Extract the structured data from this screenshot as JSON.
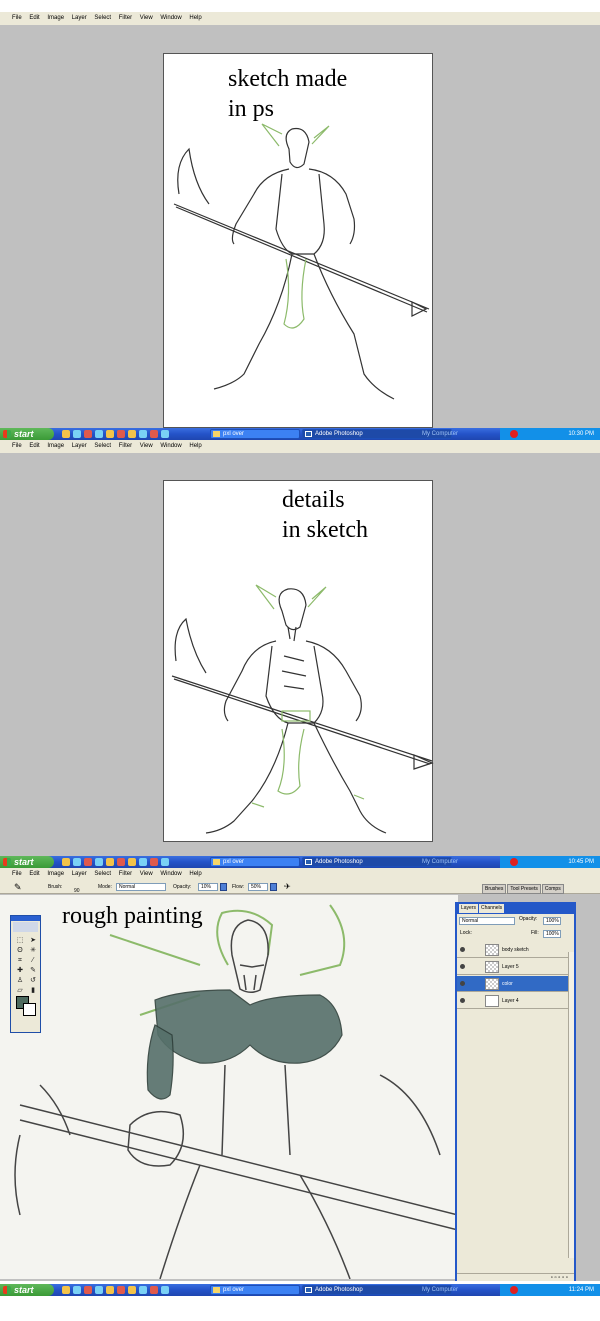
{
  "menu": [
    "File",
    "Edit",
    "Image",
    "Layer",
    "Select",
    "Filter",
    "View",
    "Window",
    "Help"
  ],
  "panels": [
    {
      "caption_line1": "sketch made",
      "caption_line2": "in ps"
    },
    {
      "caption_line1": "details",
      "caption_line2": "in sketch"
    },
    {
      "caption_line1": "rough painting"
    }
  ],
  "taskbar": {
    "start_label": "start",
    "folder_label": "pxl over",
    "app_label": "Adobe Photoshop",
    "tray_label": "My Computer",
    "times": [
      "10:30 PM",
      "10:45 PM",
      "11:24 PM"
    ]
  },
  "options_bar": {
    "brush_label": "Brush:",
    "brush_size": "90",
    "mode_label": "Mode:",
    "mode_value": "Normal",
    "opacity_label": "Opacity:",
    "opacity_value": "10%",
    "flow_label": "Flow:",
    "flow_value": "50%"
  },
  "palette_tabs": [
    "Brushes",
    "Tool Presets",
    "Comps"
  ],
  "layers_panel": {
    "tabs": [
      "Layers",
      "Channels"
    ],
    "blend_mode": "Normal",
    "opacity_label": "Opacity:",
    "opacity_value": "100%",
    "lock_label": "Lock:",
    "fill_label": "Fill:",
    "fill_value": "100%",
    "layers": [
      {
        "name": "body sketch",
        "selected": false
      },
      {
        "name": "Layer 5",
        "selected": false
      },
      {
        "name": "color",
        "selected": true
      },
      {
        "name": "Layer 4",
        "selected": false
      }
    ]
  },
  "colors": {
    "xp_blue": "#2453c8",
    "start_green": "#3a9a36",
    "fg_color": "#4d6a5e",
    "workspace_gray": "#c0c0c0"
  }
}
